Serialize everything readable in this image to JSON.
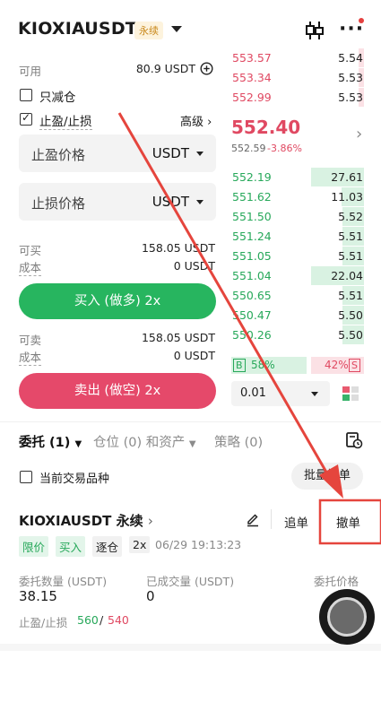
{
  "header": {
    "pair": "KIOXIAUSDT",
    "badge": "永续",
    "icons": [
      "candlestick-icon",
      "more-icon"
    ]
  },
  "form": {
    "available_label": "可用",
    "available_value": "80.9 USDT",
    "reduce_only_label": "只减仓",
    "reduce_only_checked": false,
    "tpsl_label": "止盈/止损",
    "tpsl_checked": true,
    "advanced_label": "高级",
    "tp_placeholder": "止盈价格",
    "sl_placeholder": "止损价格",
    "unit": "USDT",
    "can_buy_label": "可买",
    "can_buy_value": "158.05 USDT",
    "cost_label": "成本",
    "cost_buy_value": "0 USDT",
    "buy_button": "买入 (做多) 2x",
    "can_sell_label": "可卖",
    "can_sell_value": "158.05 USDT",
    "cost_sell_value": "0 USDT",
    "sell_button": "卖出 (做空) 2x"
  },
  "orderbook": {
    "asks": [
      {
        "price": "553.57",
        "qty": "5.54",
        "depth": 0.25
      },
      {
        "price": "553.34",
        "qty": "5.53",
        "depth": 0.25
      },
      {
        "price": "552.99",
        "qty": "5.53",
        "depth": 0.25
      }
    ],
    "last_price": "552.40",
    "mark_price": "552.59",
    "change": "-3.86%",
    "bids": [
      {
        "price": "552.19",
        "qty": "27.61",
        "depth": 1.0
      },
      {
        "price": "551.62",
        "qty": "11.03",
        "depth": 0.42
      },
      {
        "price": "551.50",
        "qty": "5.52",
        "depth": 0.2
      },
      {
        "price": "551.24",
        "qty": "5.51",
        "depth": 0.2
      },
      {
        "price": "551.05",
        "qty": "5.51",
        "depth": 0.2
      },
      {
        "price": "551.04",
        "qty": "22.04",
        "depth": 1.0
      },
      {
        "price": "550.65",
        "qty": "5.51",
        "depth": 0.2
      },
      {
        "price": "550.47",
        "qty": "5.50",
        "depth": 0.2
      },
      {
        "price": "550.26",
        "qty": "5.50",
        "depth": 0.2
      }
    ],
    "buy_ratio_label": "B",
    "buy_ratio": "58%",
    "sell_ratio": "42%",
    "sell_ratio_label": "S",
    "precision": "0.01"
  },
  "tabs": {
    "orders": "委托 (1)",
    "positions": "仓位 (0) 和资产",
    "strategies": "策略 (0)"
  },
  "filter": {
    "current_only_label": "当前交易品种",
    "batch_cancel": "批量撤单"
  },
  "order": {
    "symbol": "KIOXIAUSDT 永续",
    "chase_button": "追单",
    "cancel_button": "撤单",
    "tags": [
      "限价",
      "买入",
      "逐仓",
      "2x"
    ],
    "time": "06/29 19:13:23",
    "qty_label": "委托数量 (USDT)",
    "qty_value": "38.15",
    "filled_label": "已成交量 (USDT)",
    "filled_value": "0",
    "price_label": "委托价格",
    "tpsl_label": "止盈/止损",
    "tp_value": "560",
    "sep": "/",
    "sl_value": "540"
  },
  "colors": {
    "green": "#27a85a",
    "red": "#e04962",
    "annotation": "#e5453d"
  }
}
